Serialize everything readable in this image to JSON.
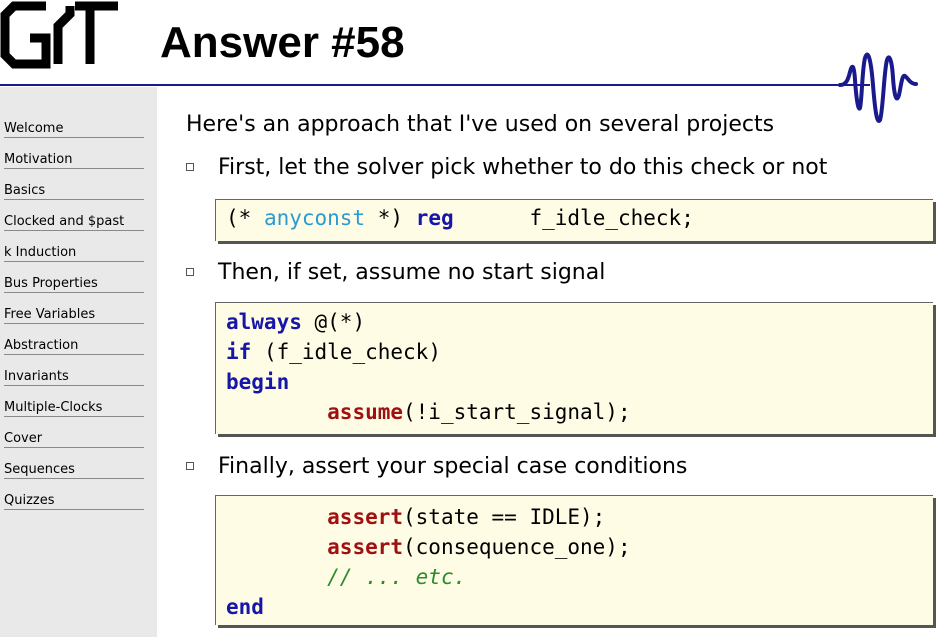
{
  "title": "Answer #58",
  "nav": [
    "Welcome",
    "Motivation",
    "Basics",
    "Clocked and $past",
    "k Induction",
    "Bus Properties",
    "Free Variables",
    "Abstraction",
    "Invariants",
    "Multiple-Clocks",
    "Cover",
    "Sequences",
    "Quizzes"
  ],
  "intro": "Here's an approach that I've used on several projects",
  "bullets": [
    "First, let the solver pick whether to do this check or not",
    "Then, if set, assume no start signal",
    "Finally, assert your special case conditions"
  ],
  "code1": {
    "comment_open": "(* ",
    "attr": "anyconst",
    "comment_close": " *)",
    "kw_reg": "reg",
    "ident": "f_idle_check;"
  },
  "code2": {
    "kw_always": "always",
    "sens": "@(*)",
    "kw_if": "if",
    "cond": "(f_idle_check)",
    "kw_begin": "begin",
    "kw_assume": "assume",
    "assume_arg": "(!i_start_signal);"
  },
  "code3": {
    "kw_assert1": "assert",
    "arg1": "(state == IDLE);",
    "kw_assert2": "assert",
    "arg2": "(consequence_one);",
    "comment": "// ... etc.",
    "kw_end": "end"
  },
  "colors": {
    "keyword": "#1616a8",
    "sv_keyword": "#a01010",
    "comment": "#2a8c2a",
    "attribute": "#2a9ad0",
    "code_bg": "#fffce6",
    "rule": "#1a1a8c"
  }
}
